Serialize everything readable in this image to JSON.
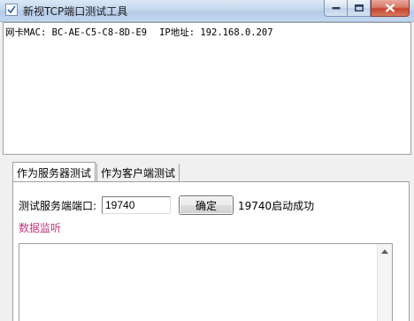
{
  "window": {
    "title": "新视TCP端口测试工具",
    "app_icon": "checkmark-icon",
    "controls": [
      "minimize-icon",
      "maximize-icon",
      "close-icon"
    ]
  },
  "info": {
    "mac_label": "网卡MAC:",
    "mac_value": "BC-AE-C5-C8-8D-E9",
    "ip_label": "IP地址:",
    "ip_value": "192.168.0.207"
  },
  "tabs": [
    {
      "label": "作为服务器测试",
      "active": true
    },
    {
      "label": "作为客户端测试",
      "active": false
    }
  ],
  "server_panel": {
    "port_label": "测试服务端端口:",
    "port_value": "19740",
    "confirm_label": "确定",
    "status_text": "19740启动成功",
    "monitor_label": "数据监听"
  },
  "colors": {
    "title_gradient_top": "#dbe7f5",
    "close_button": "#c6452f",
    "monitor_label": "#c0387a"
  }
}
